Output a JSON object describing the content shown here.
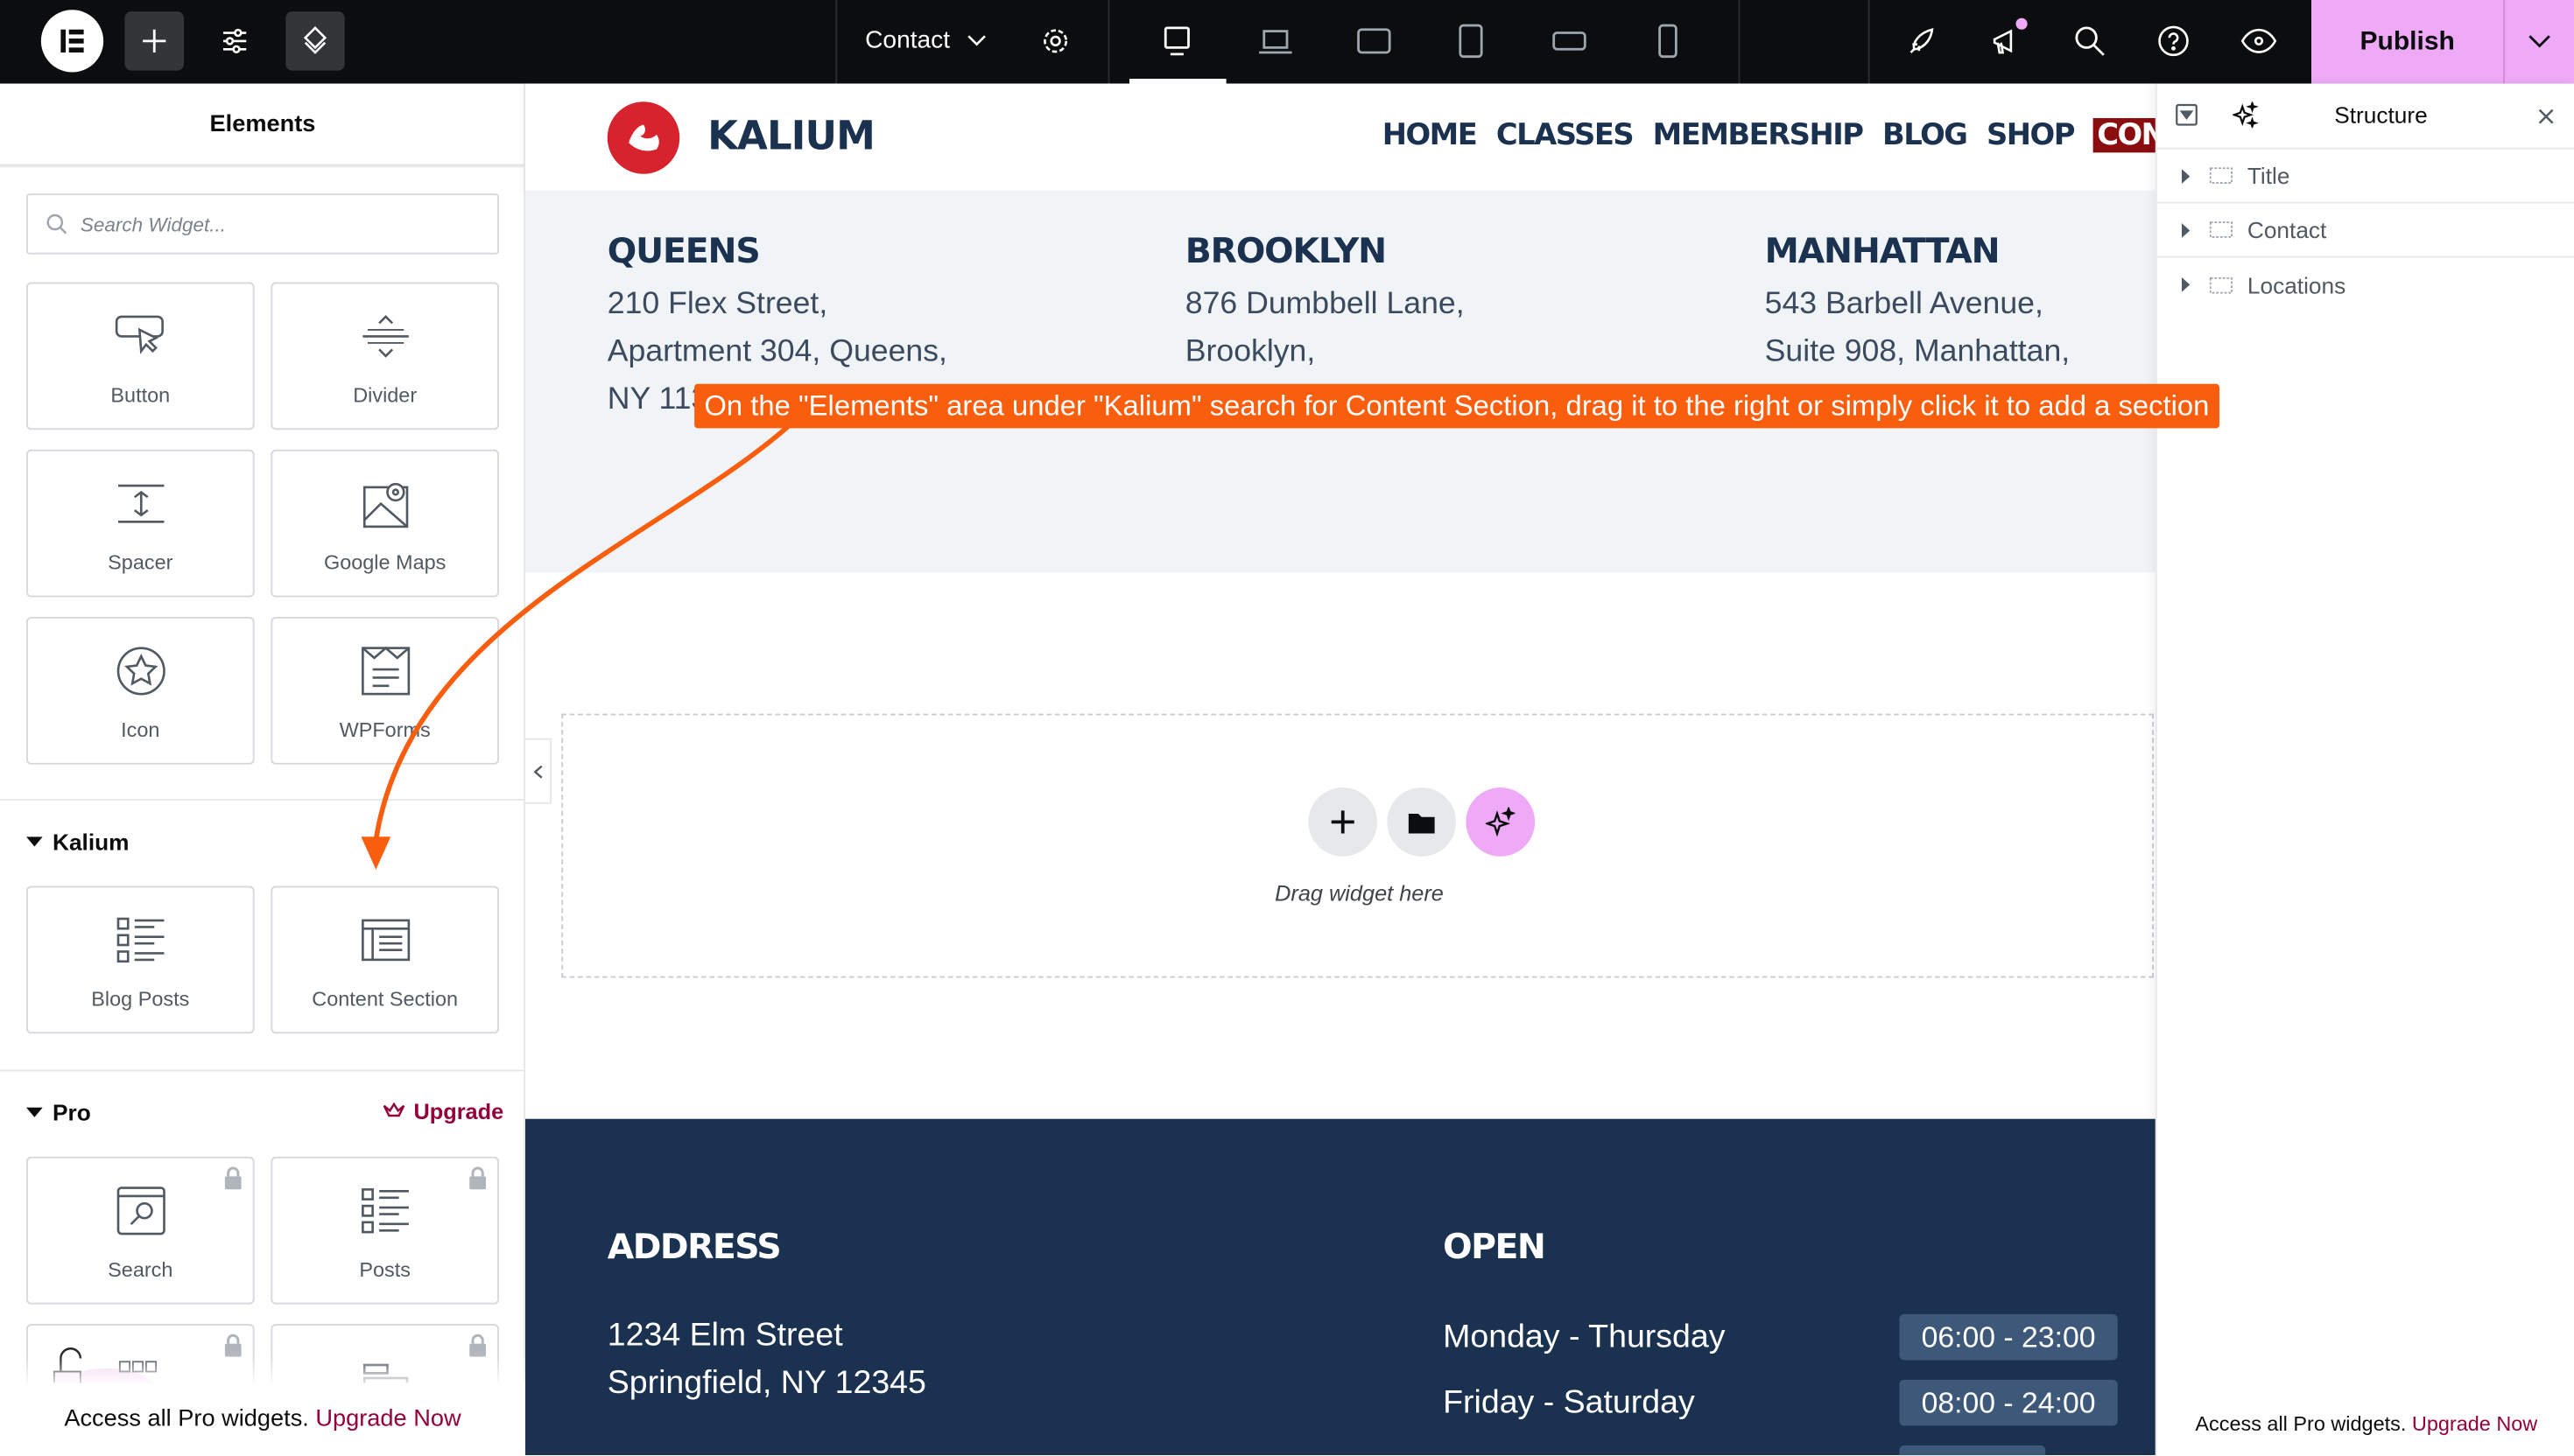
{
  "topbar": {
    "page_title": "Contact",
    "publish_label": "Publish",
    "accent_color": "#eeaaf7",
    "devices": [
      "desktop",
      "laptop",
      "tablet-landscape",
      "tablet",
      "mobile-landscape",
      "mobile"
    ]
  },
  "elements_panel": {
    "title": "Elements",
    "search_placeholder": "Search Widget...",
    "basic_widgets": [
      {
        "label": "Button",
        "icon": "button-cursor-icon"
      },
      {
        "label": "Divider",
        "icon": "divider-icon"
      },
      {
        "label": "Spacer",
        "icon": "spacer-icon"
      },
      {
        "label": "Google Maps",
        "icon": "map-icon"
      },
      {
        "label": "Icon",
        "icon": "star-circle-icon"
      },
      {
        "label": "WPForms",
        "icon": "form-icon"
      }
    ],
    "kalium": {
      "title": "Kalium",
      "widgets": [
        {
          "label": "Blog Posts",
          "icon": "list-icon"
        },
        {
          "label": "Content Section",
          "icon": "content-section-icon"
        }
      ]
    },
    "pro": {
      "title": "Pro",
      "upgrade_label": "Upgrade",
      "widgets": [
        {
          "label": "Search",
          "icon": "search-window-icon"
        },
        {
          "label": "Posts",
          "icon": "posts-list-icon"
        }
      ]
    },
    "banner": {
      "text": "Access all Pro widgets.",
      "link": "Upgrade Now"
    }
  },
  "site": {
    "brand": "KALIUM",
    "nav": [
      "HOME",
      "CLASSES",
      "MEMBERSHIP",
      "BLOG",
      "SHOP",
      "CONTAC"
    ],
    "locations": [
      {
        "name": "QUEENS",
        "lines": [
          "210 Flex Street,",
          "Apartment 304, Queens,",
          "NY 113"
        ]
      },
      {
        "name": "BROOKLYN",
        "lines": [
          "876 Dumbbell Lane,",
          "Brooklyn,"
        ]
      },
      {
        "name": "MANHATTAN",
        "lines": [
          "543 Barbell Avenue,",
          "Suite 908, Manhattan,"
        ]
      }
    ],
    "drop_hint": "Drag widget here",
    "footer": {
      "address_title": "ADDRESS",
      "address_lines": [
        "1234 Elm Street",
        "Springfield, NY 12345"
      ],
      "open_title": "OPEN",
      "hours": [
        {
          "days": "Monday - Thursday",
          "time": "06:00 - 23:00"
        },
        {
          "days": "Friday - Saturday",
          "time": "08:00 - 24:00"
        }
      ]
    }
  },
  "structure": {
    "title": "Structure",
    "items": [
      "Title",
      "Contact",
      "Locations"
    ],
    "banner": {
      "text": "Access all Pro widgets.",
      "link": "Upgrade Now"
    }
  },
  "annotation": {
    "text": "On the \"Elements\" area under \"Kalium\" search for Content Section, drag it to the right or simply click it to add a section",
    "color": "#f95d0e"
  }
}
